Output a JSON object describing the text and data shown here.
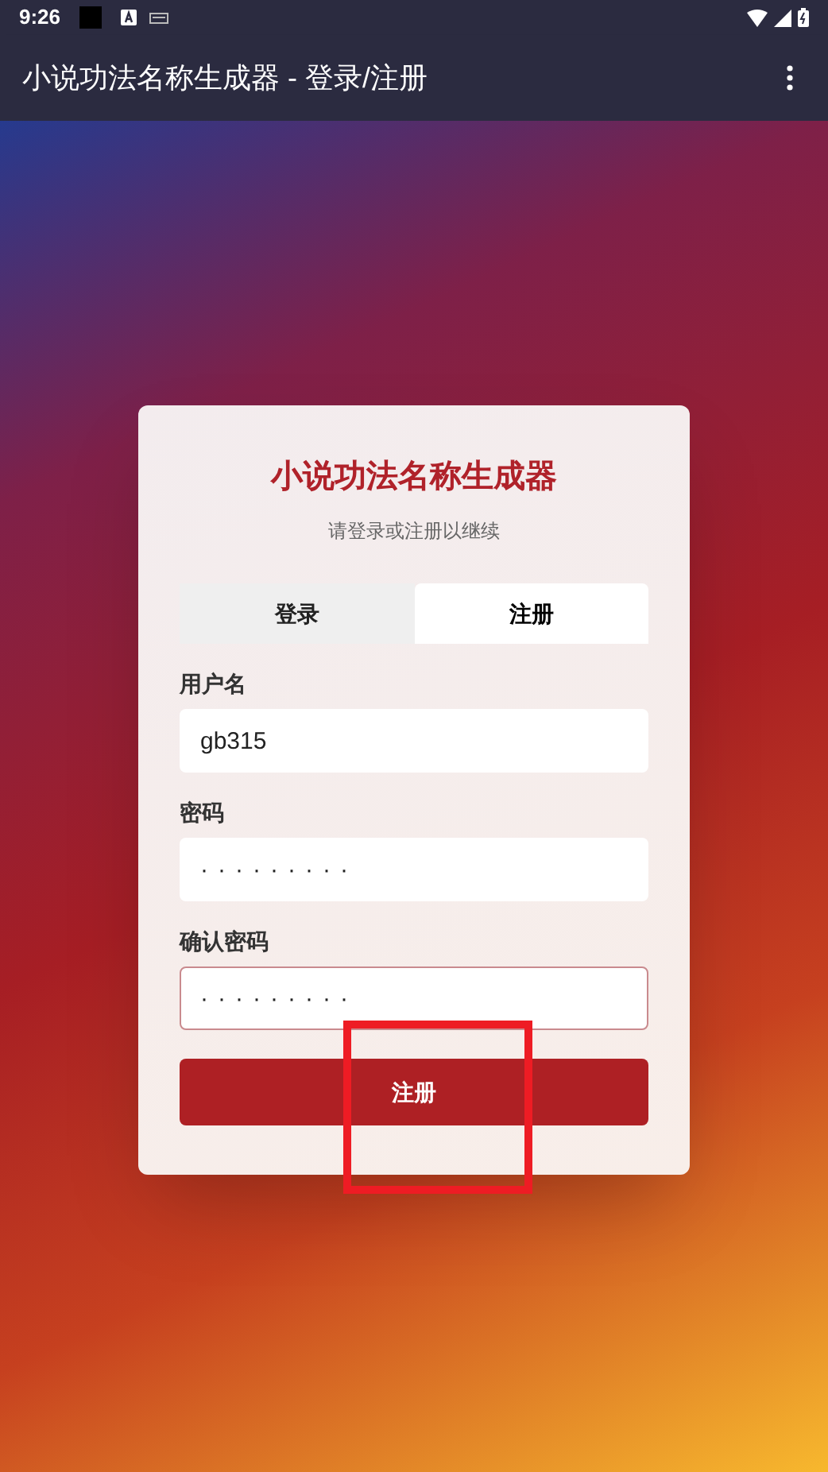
{
  "status_bar": {
    "time": "9:26"
  },
  "app_bar": {
    "title": "小说功法名称生成器 - 登录/注册"
  },
  "card": {
    "title": "小说功法名称生成器",
    "subtitle": "请登录或注册以继续",
    "tabs": [
      {
        "label": "登录",
        "selected": false
      },
      {
        "label": "注册",
        "selected": true
      }
    ],
    "fields": [
      {
        "label": "用户名",
        "value": "gb315",
        "focused": false
      },
      {
        "label": "密码",
        "value": "·········",
        "focused": false
      },
      {
        "label": "确认密码",
        "value": "·········",
        "focused": true
      }
    ],
    "submit": "注册"
  }
}
